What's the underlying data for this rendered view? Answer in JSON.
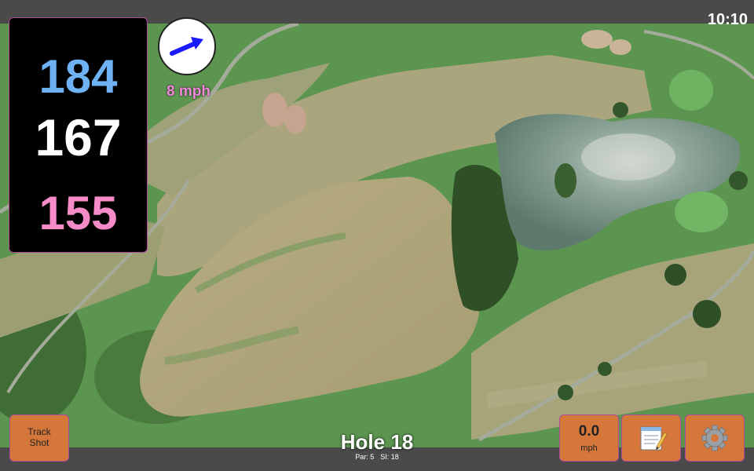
{
  "status_bar": {
    "time": "10:10"
  },
  "distances": {
    "back": "184",
    "middle": "167",
    "front": "155"
  },
  "wind": {
    "speed": "8 mph",
    "direction_icon": "wind-arrow-icon",
    "color": "#1a1aff"
  },
  "buttons": {
    "track_shot_label": "Track\nShot",
    "speed_value": "0.0",
    "speed_unit": "mph",
    "notes_icon": "notepad-icon",
    "settings_icon": "gear-icon"
  },
  "hole": {
    "title": "Hole 18",
    "par": "Par: 5",
    "stroke_index": "SI: 18"
  },
  "colors": {
    "back": "#6fb2f3",
    "middle": "#ffffff",
    "front": "#f58cc8",
    "button": "#d5773b",
    "accent": "#b04a9a"
  }
}
